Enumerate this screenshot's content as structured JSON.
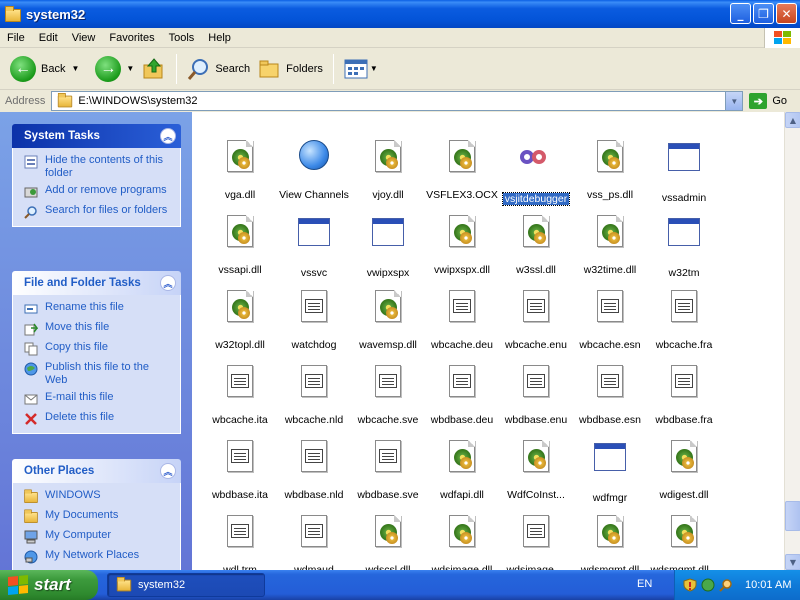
{
  "window": {
    "title": "system32",
    "buttons": {
      "minimize": "_",
      "maximize": "❐",
      "close": "✕"
    }
  },
  "menu": [
    "File",
    "Edit",
    "View",
    "Favorites",
    "Tools",
    "Help"
  ],
  "toolbar": {
    "back": "Back",
    "search": "Search",
    "folders": "Folders"
  },
  "address": {
    "label": "Address",
    "value": "E:\\WINDOWS\\system32",
    "go": "Go"
  },
  "tasks": {
    "system": {
      "title": "System Tasks",
      "items": [
        "Hide the contents of this folder",
        "Add or remove programs",
        "Search for files or folders"
      ]
    },
    "file": {
      "title": "File and Folder Tasks",
      "items": [
        "Rename this file",
        "Move this file",
        "Copy this file",
        "Publish this file to the Web",
        "E-mail this file",
        "Delete this file"
      ]
    },
    "places": {
      "title": "Other Places",
      "items": [
        "WINDOWS",
        "My Documents",
        "My Computer",
        "My Network Places"
      ]
    }
  },
  "files": [
    {
      "name": "vga.dll",
      "icon": "dll"
    },
    {
      "name": "View Channels",
      "icon": "globe"
    },
    {
      "name": "vjoy.dll",
      "icon": "dll"
    },
    {
      "name": "VSFLEX3.OCX",
      "icon": "dll"
    },
    {
      "name": "vsjitdebugger",
      "icon": "vs",
      "selected": true
    },
    {
      "name": "vss_ps.dll",
      "icon": "dll"
    },
    {
      "name": "vssadmin",
      "icon": "exe"
    },
    {
      "name": "vssapi.dll",
      "icon": "dll"
    },
    {
      "name": "vssvc",
      "icon": "exe"
    },
    {
      "name": "vwipxspx",
      "icon": "exe"
    },
    {
      "name": "vwipxspx.dll",
      "icon": "dll"
    },
    {
      "name": "w3ssl.dll",
      "icon": "dll"
    },
    {
      "name": "w32time.dll",
      "icon": "dll"
    },
    {
      "name": "w32tm",
      "icon": "exe"
    },
    {
      "name": "w32topl.dll",
      "icon": "dll"
    },
    {
      "name": "watchdog",
      "icon": "doc"
    },
    {
      "name": "wavemsp.dll",
      "icon": "dll"
    },
    {
      "name": "wbcache.deu",
      "icon": "doc"
    },
    {
      "name": "wbcache.enu",
      "icon": "doc"
    },
    {
      "name": "wbcache.esn",
      "icon": "doc"
    },
    {
      "name": "wbcache.fra",
      "icon": "doc"
    },
    {
      "name": "wbcache.ita",
      "icon": "doc"
    },
    {
      "name": "wbcache.nld",
      "icon": "doc"
    },
    {
      "name": "wbcache.sve",
      "icon": "doc"
    },
    {
      "name": "wbdbase.deu",
      "icon": "doc"
    },
    {
      "name": "wbdbase.enu",
      "icon": "doc"
    },
    {
      "name": "wbdbase.esn",
      "icon": "doc"
    },
    {
      "name": "wbdbase.fra",
      "icon": "doc"
    },
    {
      "name": "wbdbase.ita",
      "icon": "doc"
    },
    {
      "name": "wbdbase.nld",
      "icon": "doc"
    },
    {
      "name": "wbdbase.sve",
      "icon": "doc"
    },
    {
      "name": "wdfapi.dll",
      "icon": "dll"
    },
    {
      "name": "WdfCoInst...",
      "icon": "dll"
    },
    {
      "name": "wdfmgr",
      "icon": "exe"
    },
    {
      "name": "wdigest.dll",
      "icon": "dll"
    },
    {
      "name": "wdl.trm",
      "icon": "doc"
    },
    {
      "name": "wdmaud",
      "icon": "doc"
    },
    {
      "name": "wdscsl.dll",
      "icon": "dll"
    },
    {
      "name": "wdsimage.dll",
      "icon": "dll"
    },
    {
      "name": "wdsimage....",
      "icon": "doc"
    },
    {
      "name": "wdsmgmt.dll",
      "icon": "dll"
    },
    {
      "name": "wdsmgmt.dll...",
      "icon": "dll"
    }
  ],
  "taskbar": {
    "start": "start",
    "window": "system32",
    "language": "EN",
    "clock": "10:01 AM"
  },
  "colors": {
    "titlebar": "#0454d8",
    "selection": "#316ac5",
    "taskLink": "#215dc6",
    "startButton": "#3d9b3d"
  }
}
